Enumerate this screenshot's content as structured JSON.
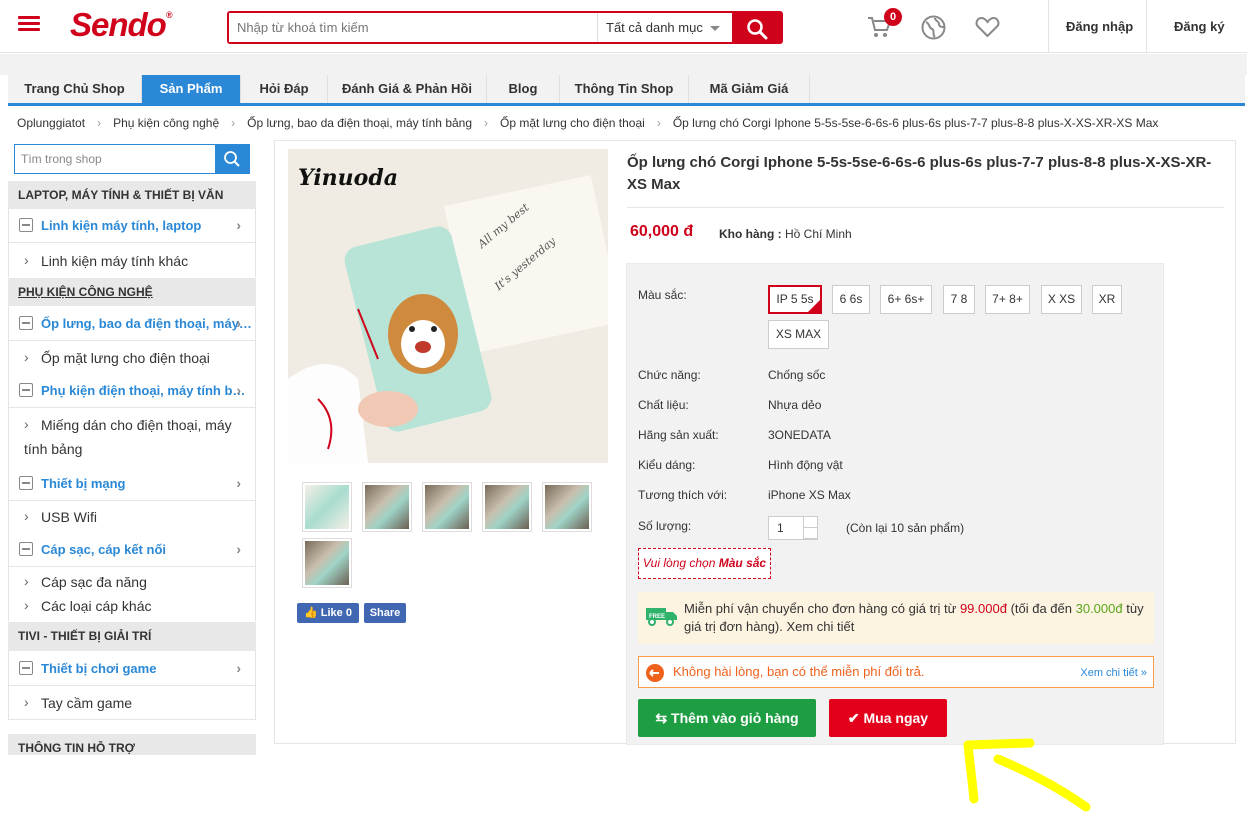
{
  "header": {
    "logo": "Sendo",
    "search_placeholder": "Nhập từ khoá tìm kiếm",
    "category_select": "Tất cả danh mục",
    "cart_count": "0",
    "login": "Đăng nhập",
    "register": "Đăng ký"
  },
  "nav": {
    "tabs": [
      {
        "label": "Trang Chủ Shop"
      },
      {
        "label": "Sản Phẩm"
      },
      {
        "label": "Hỏi Đáp"
      },
      {
        "label": "Đánh Giá & Phản Hồi"
      },
      {
        "label": "Blog"
      },
      {
        "label": "Thông Tin Shop"
      },
      {
        "label": "Mã Giảm Giá"
      }
    ]
  },
  "breadcrumb": [
    "Oplunggiatot",
    "Phụ kiện công nghệ",
    "Ốp lưng, bao da điện thoại, máy tính bảng",
    "Ốp mặt lưng cho điện thoại",
    "Ốp lưng chó Corgi Iphone 5-5s-5se-6-6s-6 plus-6s plus-7-7 plus-8-8 plus-X-XS-XR-XS Max"
  ],
  "sidebar": {
    "search_placeholder": "Tìm trong shop",
    "groups": [
      {
        "title": "LAPTOP, MÁY TÍNH & THIẾT BỊ VĂN"
      },
      {
        "title_main": "PHỤ KIỆN CÔNG NGHỆ"
      },
      {
        "title": "TIVI - THIẾT BỊ GIẢI TRÍ"
      },
      {
        "title": "THÔNG TIN HỖ TRỢ"
      }
    ],
    "items": [
      "Linh kiện máy tính, laptop",
      "Linh kiện máy tính khác",
      "Ốp lưng, bao da điện thoại, máy…",
      "Ốp mặt lưng cho điện thoại",
      "Phụ kiện điện thoại, máy tính b…",
      "Miếng dán cho điện thoại, máy",
      "tính bảng",
      "Thiết bị mạng",
      "USB Wifi",
      "Cáp sạc, cáp kết nối",
      "Cáp sạc đa năng",
      "Các loại cáp khác",
      "Thiết bị chơi game",
      "Tay cầm game"
    ]
  },
  "product": {
    "image_brand": "Yinuoda",
    "facebook_like": "Like 0",
    "facebook_share": "Share",
    "title": "Ốp lưng chó Corgi Iphone 5-5s-5se-6-6s-6 plus-6s plus-7-7 plus-8-8 plus-X-XS-XR-XS Max",
    "price": "60,000 đ",
    "warehouse_label": "Kho hàng :",
    "warehouse_value": "Hồ Chí Minh",
    "color_label": "Màu sắc:",
    "colors": [
      "IP 5 5s",
      "6 6s",
      "6+ 6s+",
      "7 8",
      "7+ 8+",
      "X XS",
      "XR",
      "XS MAX"
    ],
    "attrs": [
      {
        "label": "Chức năng:",
        "value": "Chống sốc"
      },
      {
        "label": "Chất liệu:",
        "value": "Nhựa dẻo"
      },
      {
        "label": "Hãng sản xuất:",
        "value": "3ONEDATA"
      },
      {
        "label": "Kiểu dáng:",
        "value": "Hình động vật"
      },
      {
        "label": "Tương thích với:",
        "value": "iPhone XS Max"
      }
    ],
    "qty_label": "Số lượng:",
    "qty_value": "1",
    "stock": "(Còn lại 10 sản phẩm)",
    "warn_prefix": "Vui lòng chọn",
    "warn_bold": "Màu sắc",
    "ship_a": "Miễn phí vận chuyển cho đơn hàng có giá trị từ ",
    "ship_min": "99.000đ",
    "ship_b": " (tối đa đến ",
    "ship_max": "30.000đ",
    "ship_c": " tùy giá trị đơn hàng). Xem chi tiết",
    "ship_badge": "FREE",
    "return_text": "Không hài lòng, bạn có thể miễn phí đổi trả.",
    "return_more": "Xem chi tiết »",
    "add_cart": "Thêm vào giỏ hàng",
    "buy_now": "Mua ngay"
  },
  "colors": {
    "brand_red": "#d0021b",
    "blue": "#2a88d6",
    "green": "#1e9e43",
    "arrow_yellow": "#ffff00"
  }
}
